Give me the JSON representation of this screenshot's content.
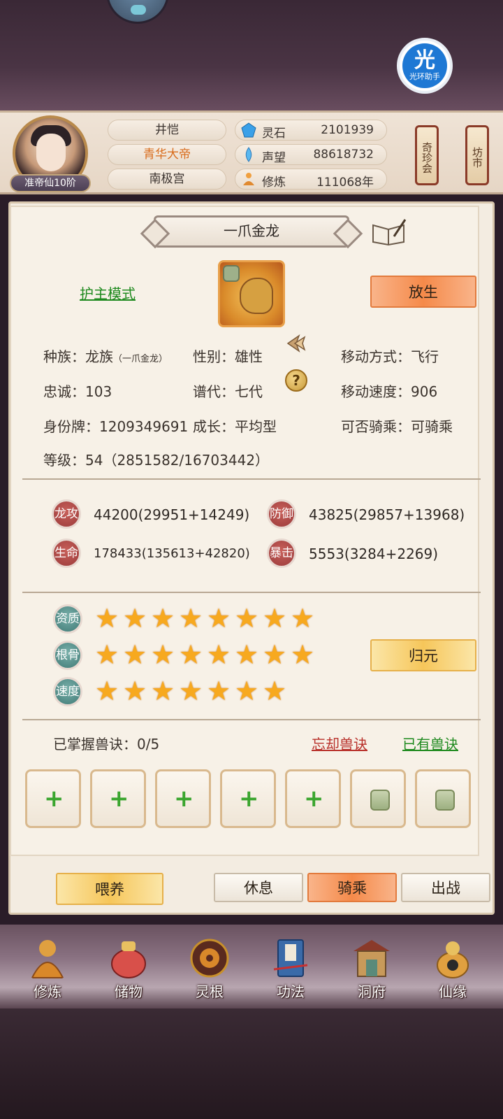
{
  "helper": {
    "glyph": "光",
    "label": "光环助手"
  },
  "profile": {
    "rank": "准帝仙10阶",
    "name": "井恺",
    "title": "青华大帝",
    "sect": "南极宫"
  },
  "resources": [
    {
      "icon": "spirit-stone-icon",
      "label": "灵石",
      "value": "2101939"
    },
    {
      "icon": "prestige-icon",
      "label": "声望",
      "value": "88618732"
    },
    {
      "icon": "cultivation-icon",
      "label": "修炼",
      "value": "111068年"
    }
  ],
  "side_buttons": {
    "treasure": "奇珍会",
    "market": "坊市"
  },
  "pet": {
    "name": "一爪金龙",
    "mode_link": "护主模式",
    "release_button": "放生",
    "stats": {
      "race_label": "种族：",
      "race": "龙族",
      "race_sub": "（一爪金龙）",
      "gender_label": "性别：",
      "gender": "雄性",
      "move_label": "移动方式：",
      "move": "飞行",
      "loyalty_label": "忠诚：",
      "loyalty": "103",
      "generation_label": "谱代：",
      "generation": "七代",
      "speed_label": "移动速度：",
      "speed": "906",
      "id_label": "身份牌：",
      "id": "1209349691",
      "growth_label": "成长：",
      "growth": "平均型",
      "ride_label": "可否骑乘：",
      "ride": "可骑乘",
      "level_label": "等级：",
      "level": "54（2851582/16703442）"
    },
    "attributes": {
      "attack_badge": "龙攻",
      "attack": "44200(29951+14249)",
      "defense_badge": "防御",
      "defense": "43825(29857+13968)",
      "life_badge": "生命",
      "life": "178433(135613+42820)",
      "crit_badge": "暴击",
      "crit": "5553(3284+2269)"
    },
    "talents": {
      "aptitude_label": "资质",
      "aptitude_stars": 8,
      "bone_label": "根骨",
      "bone_stars": 8,
      "speed_label": "速度",
      "speed_stars": 7,
      "reset_button": "归元"
    },
    "skills": {
      "mastered": "已掌握兽诀：0/5",
      "forget_link": "忘却兽诀",
      "owned_link": "已有兽诀",
      "slots": [
        "open",
        "open",
        "open",
        "open",
        "open",
        "locked",
        "locked"
      ]
    },
    "actions": {
      "feed": "喂养",
      "rest": "休息",
      "ride": "骑乘",
      "battle": "出战"
    }
  },
  "nav": [
    {
      "label": "修炼",
      "icon": "cultivate-icon"
    },
    {
      "label": "储物",
      "icon": "storage-bag-icon"
    },
    {
      "label": "灵根",
      "icon": "spirit-root-icon"
    },
    {
      "label": "功法",
      "icon": "technique-book-icon"
    },
    {
      "label": "洞府",
      "icon": "cave-dwelling-icon"
    },
    {
      "label": "仙缘",
      "icon": "immortal-fate-icon"
    }
  ],
  "colors": {
    "accent_orange": "#f58a4a",
    "gold": "#f6c65a",
    "link_green": "#1f8a1f",
    "link_red": "#b8302a",
    "star": "#f7a91f"
  }
}
